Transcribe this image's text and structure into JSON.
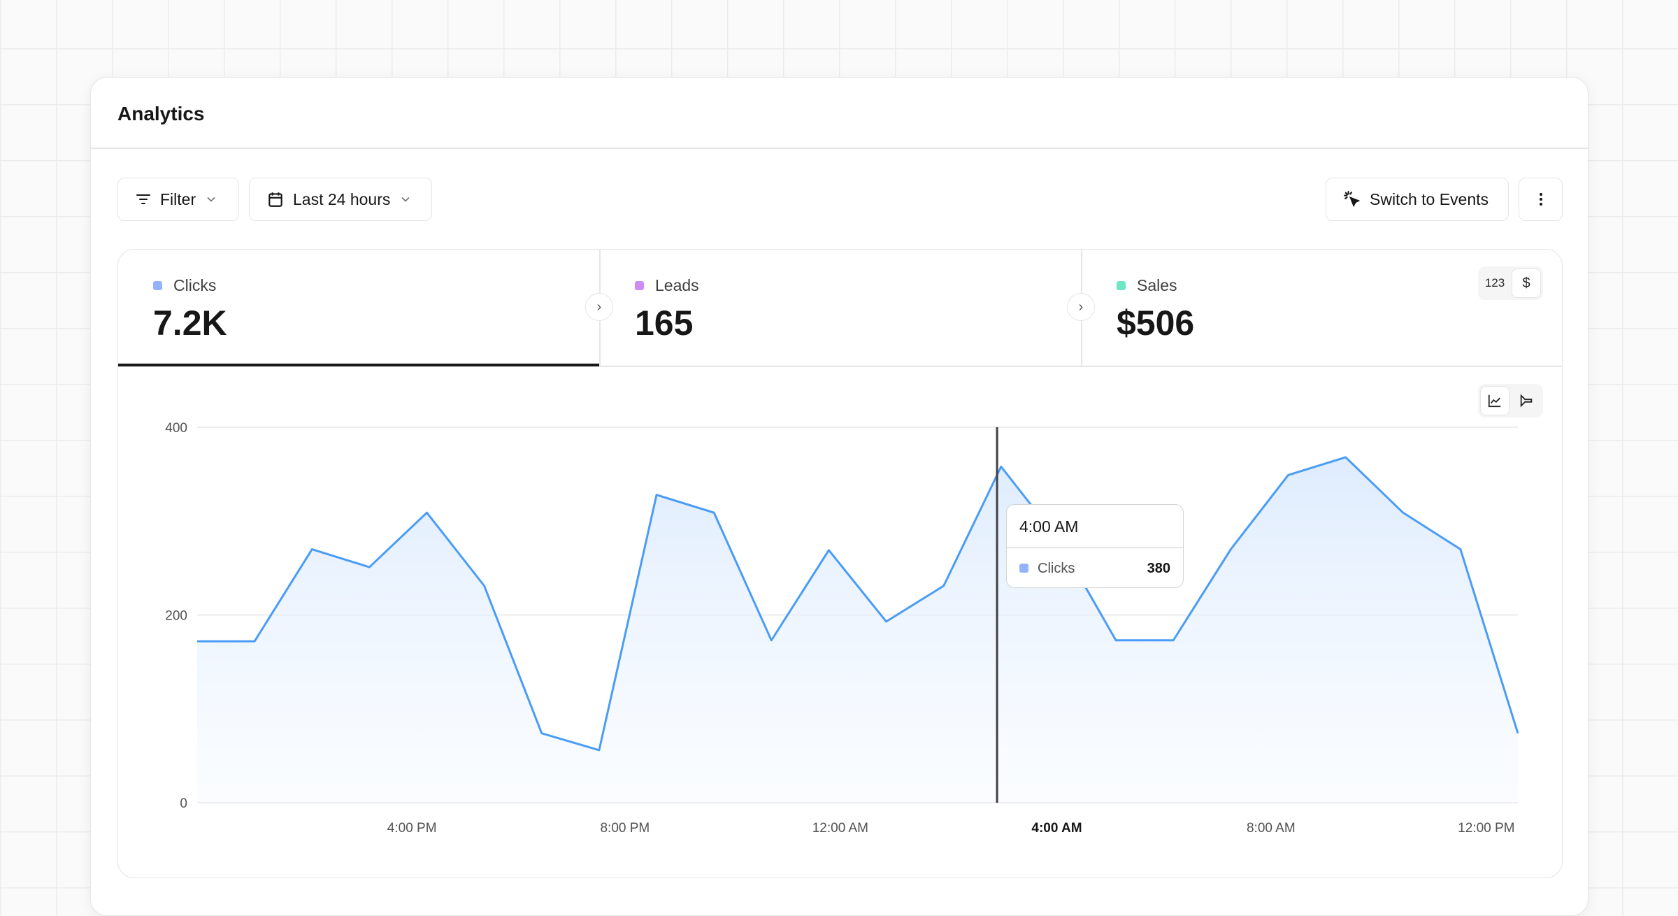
{
  "header": {
    "title": "Analytics"
  },
  "toolbar": {
    "filter_label": "Filter",
    "date_label": "Last 24 hours",
    "switch_label": "Switch to Events",
    "more_icon": "more-vertical-icon"
  },
  "stats": [
    {
      "label": "Clicks",
      "value": "7.2K",
      "color": "#93b4fd",
      "active": true
    },
    {
      "label": "Leads",
      "value": "165",
      "color": "#d08cf5"
    },
    {
      "label": "Sales",
      "value": "$506",
      "color": "#6ee7c8"
    }
  ],
  "sales_toggle": {
    "options": [
      "123",
      "$"
    ],
    "selected": "$"
  },
  "chart_toggle": {
    "options": [
      "line-chart-icon",
      "funnel-icon"
    ],
    "selected": "line-chart-icon"
  },
  "tooltip": {
    "title": "4:00 AM",
    "series": "Clicks",
    "value": "380"
  },
  "chart_data": {
    "type": "area",
    "series": [
      {
        "name": "Clicks",
        "color": "#4a9cf6",
        "values": [
          172,
          172,
          270,
          251,
          309,
          231,
          74,
          56,
          328,
          309,
          173,
          269,
          193,
          231,
          358,
          280,
          173,
          173,
          270,
          349,
          368,
          309,
          270,
          74
        ]
      }
    ],
    "ylim": [
      0,
      400
    ],
    "yticks": [
      0,
      200,
      400
    ],
    "xticks": [
      {
        "label": "4:00 PM",
        "at": 3.74
      },
      {
        "label": "8:00 PM",
        "at": 7.45
      },
      {
        "label": "12:00 AM",
        "at": 11.2
      },
      {
        "label": "4:00 AM",
        "at": 14.97,
        "bold": true
      },
      {
        "label": "8:00 AM",
        "at": 18.7
      },
      {
        "label": "12:00 PM",
        "at": 22.45
      }
    ],
    "cursor_at": 13.93,
    "grid": true
  }
}
